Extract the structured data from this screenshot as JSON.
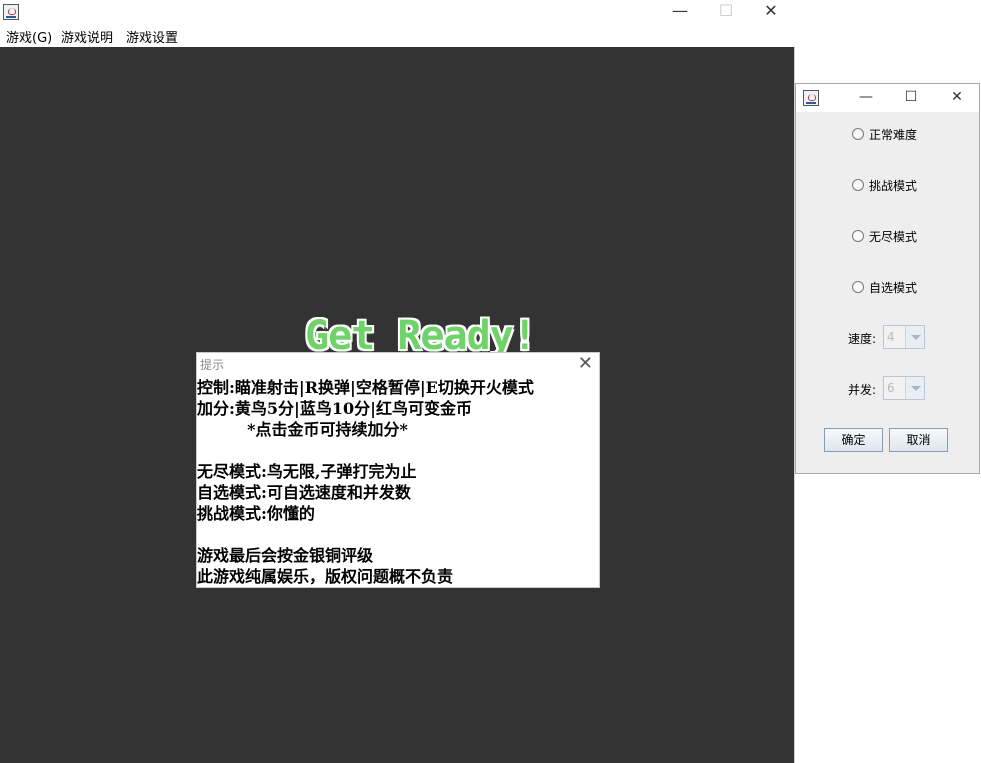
{
  "main_window": {
    "title": "",
    "controls": {
      "minimize": "—",
      "maximize": "☐",
      "close": "✕"
    },
    "menu": [
      {
        "label": "游戏(G)"
      },
      {
        "label": "游戏说明"
      },
      {
        "label": "游戏设置"
      }
    ],
    "canvas": {
      "background": "#333333",
      "banner": "Get Ready!",
      "banner_color": "#6fd36a"
    }
  },
  "tip_dialog": {
    "title": "提示",
    "close": "✕",
    "lines": [
      "控制:瞄准射击|R换弹|空格暂停|E切换开火模式",
      "加分:黄鸟5分|蓝鸟10分|红鸟可变金币",
      "         *点击金币可持续加分*",
      "",
      "无尽模式:鸟无限,子弹打完为止",
      "自选模式:可自选速度和并发数",
      "挑战模式:你懂的",
      "",
      "游戏最后会按金银铜评级",
      "此游戏纯属娱乐，版权问题概不负责"
    ]
  },
  "settings_dialog": {
    "controls": {
      "minimize": "—",
      "maximize": "☐",
      "close": "✕"
    },
    "options": [
      {
        "label": "正常难度",
        "selected": false
      },
      {
        "label": "挑战模式",
        "selected": false
      },
      {
        "label": "无尽模式",
        "selected": false
      },
      {
        "label": "自选模式",
        "selected": false
      }
    ],
    "speed": {
      "label": "速度:",
      "value": "4",
      "enabled": false
    },
    "concurrency": {
      "label": "并发:",
      "value": "6",
      "enabled": false
    },
    "confirm_label": "确定",
    "cancel_label": "取消"
  }
}
